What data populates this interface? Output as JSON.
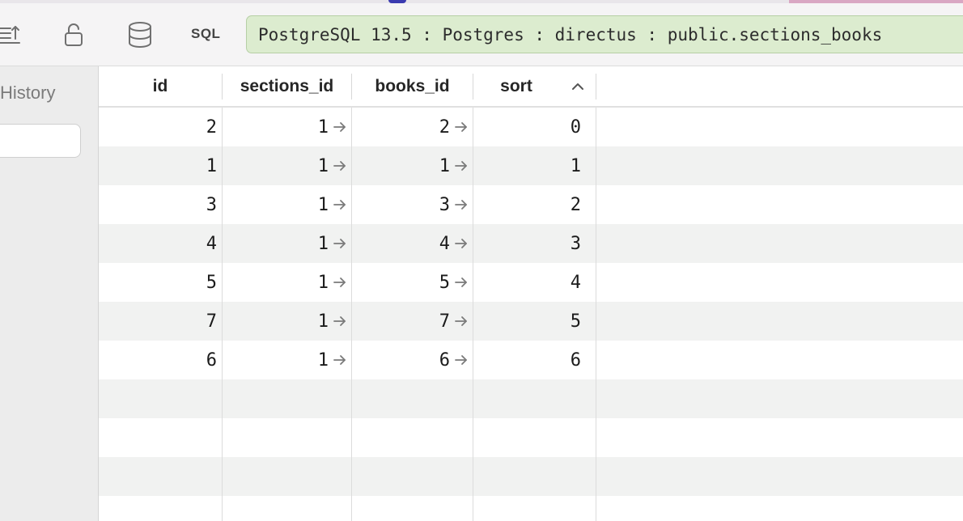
{
  "toolbar": {
    "sql_label": "SQL",
    "connection": "PostgreSQL 13.5 : Postgres : directus : public.sections_books"
  },
  "sidebar": {
    "history_label": "History"
  },
  "table": {
    "columns": [
      "id",
      "sections_id",
      "books_id",
      "sort"
    ],
    "sort_column": "sort",
    "sort_direction": "ascending",
    "rows": [
      {
        "id": "2",
        "sections_id": "1",
        "books_id": "2",
        "sort": "0"
      },
      {
        "id": "1",
        "sections_id": "1",
        "books_id": "1",
        "sort": "1"
      },
      {
        "id": "3",
        "sections_id": "1",
        "books_id": "3",
        "sort": "2"
      },
      {
        "id": "4",
        "sections_id": "1",
        "books_id": "4",
        "sort": "3"
      },
      {
        "id": "5",
        "sections_id": "1",
        "books_id": "5",
        "sort": "4"
      },
      {
        "id": "7",
        "sections_id": "1",
        "books_id": "7",
        "sort": "5"
      },
      {
        "id": "6",
        "sections_id": "1",
        "books_id": "6",
        "sort": "6"
      }
    ]
  },
  "icons": {
    "structure": "structure-icon",
    "lock": "lock-open-icon",
    "database": "database-icon",
    "foreign_key": "arrow-right-icon",
    "sort": "chevron-up-icon"
  }
}
